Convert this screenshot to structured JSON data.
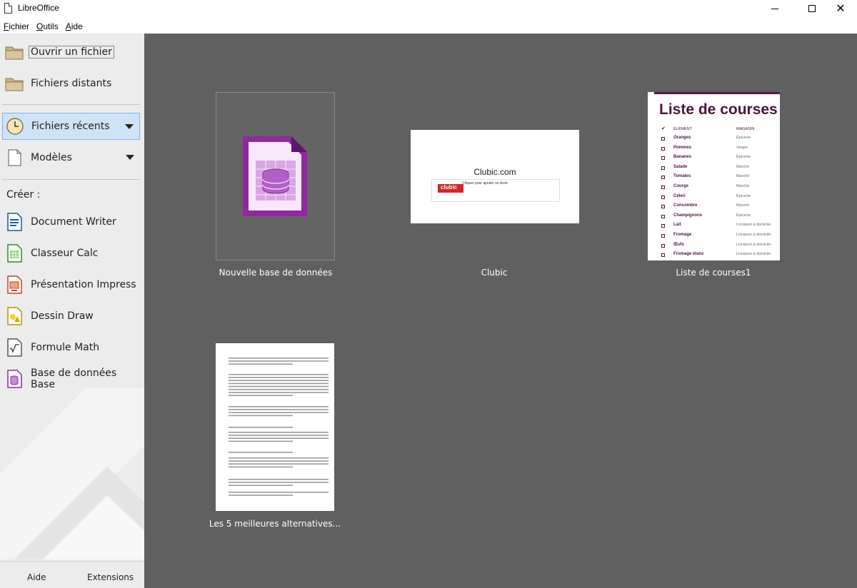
{
  "window": {
    "title": "LibreOffice",
    "close_glyph": "✕"
  },
  "menu": {
    "items": [
      {
        "label": "Fichier",
        "mnemonic": "F",
        "rest": "ichier"
      },
      {
        "label": "Outils",
        "mnemonic": "O",
        "rest": "utils"
      },
      {
        "label": "Aide",
        "mnemonic": "A",
        "rest": "ide"
      }
    ]
  },
  "sidebar": {
    "open_file": "Ouvrir un fichier",
    "remote_files": "Fichiers distants",
    "recent_files": "Fichiers récents",
    "templates": "Modèles",
    "create_label": "Créer :",
    "create_items": [
      {
        "label": "Document Writer",
        "icon": "writer-icon"
      },
      {
        "label": "Classeur Calc",
        "icon": "calc-icon"
      },
      {
        "label": "Présentation Impress",
        "icon": "impress-icon"
      },
      {
        "label": "Dessin Draw",
        "icon": "draw-icon"
      },
      {
        "label": "Formule Math",
        "icon": "math-icon"
      },
      {
        "label": "Base de données Base",
        "icon": "base-icon"
      }
    ],
    "footer": {
      "help": "Aide",
      "extensions": "Extensions"
    }
  },
  "recent": {
    "items": [
      {
        "label": "Nouvelle base de données"
      },
      {
        "label": "Clubic"
      },
      {
        "label": "Liste de courses1"
      },
      {
        "label": "Les 5 meilleures alternatives..."
      }
    ],
    "clubic_preview": {
      "title": "Clubic.com",
      "subtitle": "Cliquez pour ajouter un texte",
      "logo": "clubic"
    },
    "courses_preview": {
      "title": "Liste de courses",
      "col_item": "ÉLÉMENT",
      "col_store": "MAGASIN",
      "rows": [
        {
          "item": "Oranges",
          "store": "Épicerie"
        },
        {
          "item": "Pommes",
          "store": "Verger"
        },
        {
          "item": "Bananes",
          "store": "Épicerie"
        },
        {
          "item": "Salade",
          "store": "Marché"
        },
        {
          "item": "Tomates",
          "store": "Marché"
        },
        {
          "item": "Courge",
          "store": "Marché"
        },
        {
          "item": "Céleri",
          "store": "Épicerie"
        },
        {
          "item": "Concombre",
          "store": "Marché"
        },
        {
          "item": "Champignons",
          "store": "Épicerie"
        },
        {
          "item": "Lait",
          "store": "Livraison à domicile"
        },
        {
          "item": "Fromage",
          "store": "Livraison à domicile"
        },
        {
          "item": "Œufs",
          "store": "Livraison à domicile"
        },
        {
          "item": "Fromage blanc",
          "store": "Livraison à domicile"
        }
      ]
    }
  },
  "colors": {
    "sidebar_bg": "#ececec",
    "main_bg": "#606060",
    "selected_bg": "#cfe3f7",
    "selected_border": "#7eb4ea",
    "base_purple": "#8e2a9e",
    "courses_accent": "#4a143d"
  }
}
